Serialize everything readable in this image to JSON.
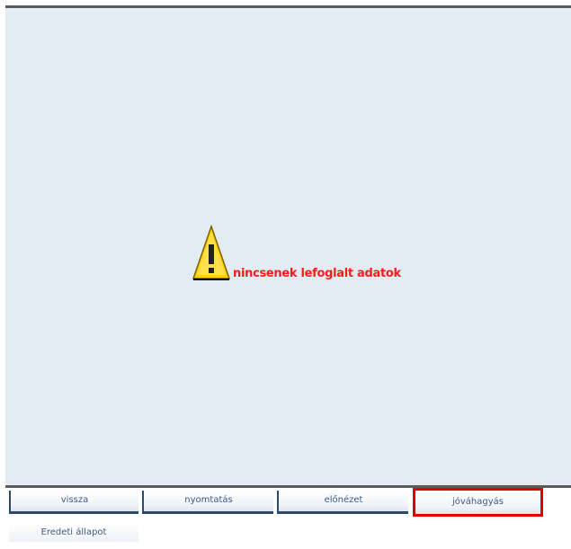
{
  "screen": {
    "message": "nincsenek lefoglalt adatok",
    "warning_icon": "warning-icon"
  },
  "buttons": [
    {
      "label": "vissza",
      "selected": false
    },
    {
      "label": "nyomtatás",
      "selected": false
    },
    {
      "label": "előnézet",
      "selected": false
    },
    {
      "label": "jóváhagyás",
      "selected": true
    }
  ],
  "extra_button": {
    "label": "Eredeti állapot"
  },
  "colors": {
    "background": "#e3ebf3",
    "message": "#ff1a1a",
    "selection_border": "#e00000",
    "button_border": "#2c4a6e"
  }
}
